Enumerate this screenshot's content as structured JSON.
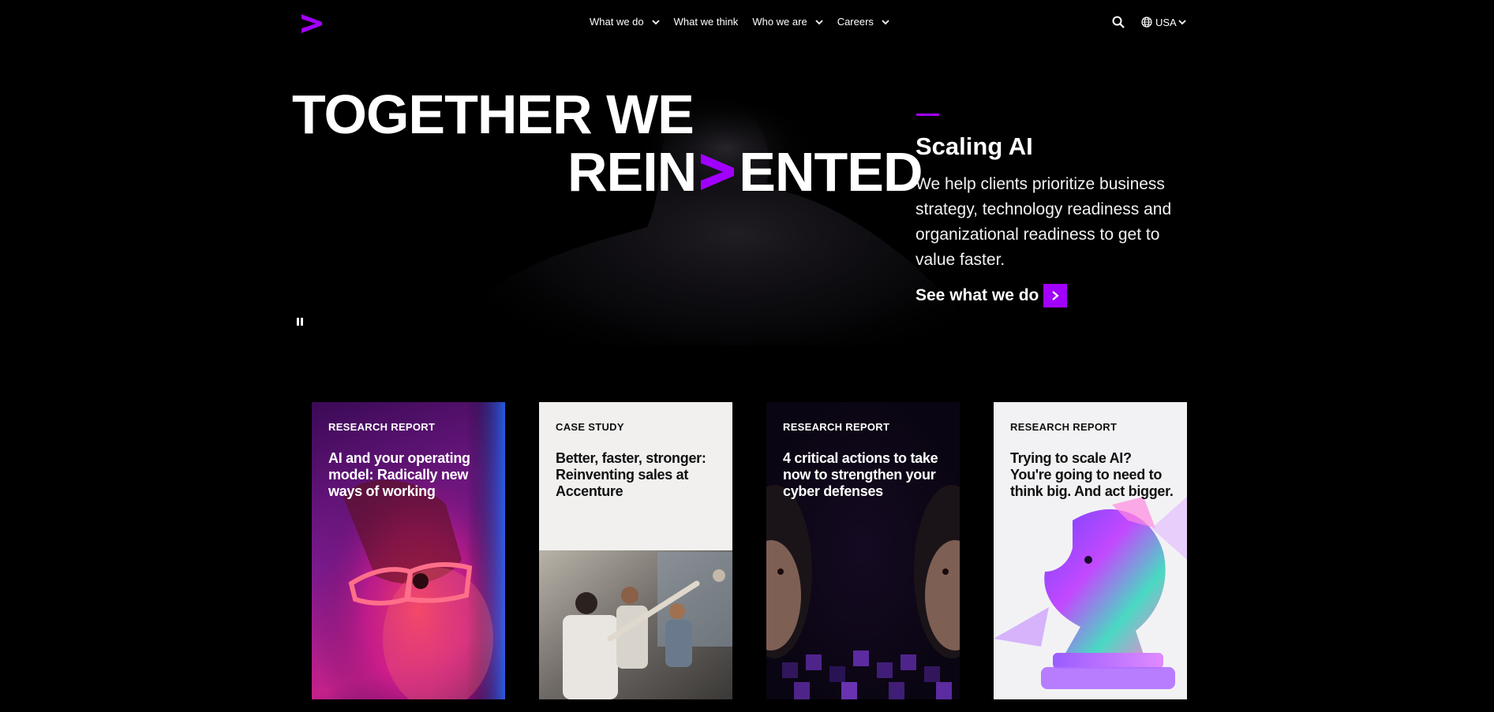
{
  "header": {
    "logo": "accenture-arrow-logo",
    "nav": [
      {
        "label": "What we do",
        "has_dropdown": true
      },
      {
        "label": "What we think",
        "has_dropdown": false
      },
      {
        "label": "Who we are",
        "has_dropdown": true
      },
      {
        "label": "Careers",
        "has_dropdown": true
      }
    ],
    "search_icon": "search-icon",
    "locale_label": "USA"
  },
  "hero": {
    "headline_line1": "TOGETHER WE",
    "headline_line2_prefix": "REIN",
    "headline_line2_suffix": "ENTED",
    "feature_title": "Scaling AI",
    "feature_description": "We help clients prioritize business strategy, technology readiness and organizational readiness to get to value faster.",
    "cta_label": "See what we do"
  },
  "cards": [
    {
      "eyebrow": "RESEARCH REPORT",
      "title": "AI and your operating model: Radically new ways of working"
    },
    {
      "eyebrow": "CASE STUDY",
      "title": "Better, faster, stronger: Reinventing sales at Accenture"
    },
    {
      "eyebrow": "RESEARCH REPORT",
      "title": "4 critical actions to take now to strengthen your cyber defenses"
    },
    {
      "eyebrow": "RESEARCH REPORT",
      "title": "Trying to scale AI? You're going to need to think big. And act bigger."
    }
  ],
  "colors": {
    "accent": "#a100ff",
    "background": "#000000"
  }
}
